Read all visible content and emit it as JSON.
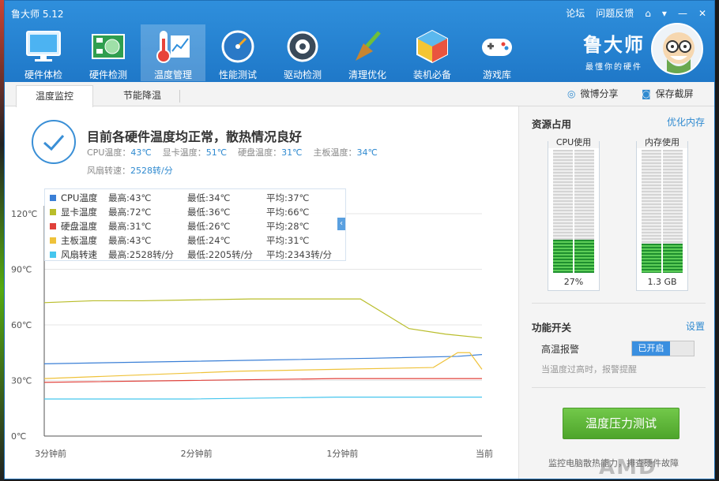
{
  "app": {
    "title": "鲁大师 5.12"
  },
  "window_controls": {
    "forum": "论坛",
    "feedback": "问题反馈"
  },
  "toolbar": [
    {
      "label": "硬件体检",
      "icon": "monitor-icon"
    },
    {
      "label": "硬件检测",
      "icon": "board-icon"
    },
    {
      "label": "温度管理",
      "icon": "thermometer-icon"
    },
    {
      "label": "性能测试",
      "icon": "gauge-icon"
    },
    {
      "label": "驱动检测",
      "icon": "gear-icon"
    },
    {
      "label": "清理优化",
      "icon": "broom-icon"
    },
    {
      "label": "装机必备",
      "icon": "cube-icon"
    },
    {
      "label": "游戏库",
      "icon": "gamepad-icon"
    }
  ],
  "brand": {
    "name": "鲁大师",
    "slogan": "最懂你的硬件"
  },
  "tabs": {
    "monitor": "温度监控",
    "cooling": "节能降温",
    "weibo": "微博分享",
    "screenshot": "保存截屏"
  },
  "status": {
    "headline": "目前各硬件温度均正常，散热情况良好",
    "cpu_label": "CPU温度：",
    "cpu": "43℃",
    "gpu_label": "显卡温度：",
    "gpu": "51℃",
    "disk_label": "硬盘温度：",
    "disk": "31℃",
    "board_label": "主板温度：",
    "board": "34℃",
    "fan_label": "风扇转速：",
    "fan": "2528转/分"
  },
  "legend": [
    {
      "name": "CPU温度",
      "max": "最高:43℃",
      "min": "最低:34℃",
      "avg": "平均:37℃",
      "color": "#3a7fd6"
    },
    {
      "name": "显卡温度",
      "max": "最高:72℃",
      "min": "最低:36℃",
      "avg": "平均:66℃",
      "color": "#b9bd2a"
    },
    {
      "name": "硬盘温度",
      "max": "最高:31℃",
      "min": "最低:26℃",
      "avg": "平均:28℃",
      "color": "#e0403a"
    },
    {
      "name": "主板温度",
      "max": "最高:43℃",
      "min": "最低:24℃",
      "avg": "平均:31℃",
      "color": "#efc23a"
    },
    {
      "name": "风扇转速",
      "max": "最高:2528转/分",
      "min": "最低:2205转/分",
      "avg": "平均:2343转/分",
      "color": "#46c6ee"
    }
  ],
  "chart_data": {
    "type": "line",
    "y_ticks": [
      "0℃",
      "30℃",
      "60℃",
      "90℃",
      "120℃"
    ],
    "x_ticks": [
      "3分钟前",
      "2分钟前",
      "1分钟前",
      "当前"
    ],
    "ylim": [
      0,
      120
    ],
    "xlim": [
      0,
      180
    ],
    "series": [
      {
        "name": "CPU温度",
        "color": "#3a7fd6",
        "x": [
          0,
          45,
          90,
          135,
          170,
          180
        ],
        "y": [
          39,
          40,
          41,
          42,
          43,
          44
        ]
      },
      {
        "name": "显卡温度",
        "color": "#b9bd2a",
        "x": [
          0,
          20,
          40,
          85,
          130,
          140,
          150,
          165,
          180
        ],
        "y": [
          72,
          73,
          73,
          74,
          74,
          66,
          58,
          55,
          53
        ]
      },
      {
        "name": "硬盘温度",
        "color": "#e0403a",
        "x": [
          0,
          60,
          120,
          180
        ],
        "y": [
          29,
          30,
          31,
          31
        ]
      },
      {
        "name": "主板温度",
        "color": "#efc23a",
        "x": [
          0,
          40,
          80,
          120,
          160,
          170,
          175,
          180
        ],
        "y": [
          31,
          33,
          35,
          36,
          37,
          45,
          45,
          36
        ]
      },
      {
        "name": "风扇转速",
        "color": "#46c6ee",
        "x": [
          0,
          60,
          120,
          180
        ],
        "y": [
          20,
          20,
          21,
          21
        ]
      }
    ]
  },
  "resources": {
    "title": "资源占用",
    "optimize": "优化内存",
    "cpu_label": "CPU使用",
    "cpu_value": "27%",
    "cpu_fraction": 0.27,
    "mem_label": "内存使用",
    "mem_value": "1.3 GB",
    "mem_fraction": 0.24
  },
  "features": {
    "title": "功能开关",
    "settings": "设置",
    "alarm_label": "高温报警",
    "alarm_state": "已开启",
    "alarm_desc": "当温度过高时，报警提醒"
  },
  "stress_button": "温度压力测试",
  "footer": "监控电脑散热能力，排查硬件故障",
  "watermark": "AMD"
}
